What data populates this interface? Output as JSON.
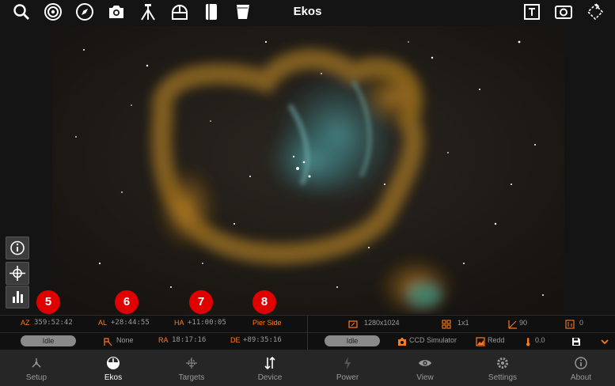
{
  "app": {
    "title": "Ekos"
  },
  "top_icons_left": [
    "search-icon",
    "target-icon",
    "compass-icon",
    "camera-icon",
    "tripod-icon",
    "observatory-icon",
    "notebook-icon",
    "flat-panel-icon"
  ],
  "top_icons_right": [
    "text-crop-icon",
    "screenshot-icon",
    "rotate-icon"
  ],
  "side_buttons": [
    "info-icon",
    "crosshair-icon",
    "histogram-icon"
  ],
  "markers": [
    "5",
    "6",
    "7",
    "8"
  ],
  "mount": {
    "az_label": "AZ",
    "az_value": "359:52:42",
    "al_label": "AL",
    "al_value": "+28:44:55",
    "ha_label": "HA",
    "ha_value": "+11:00:05",
    "pier_label": "Pier Side",
    "status": "Idle",
    "parking_value": "None",
    "ra_label": "RA",
    "ra_value": "18:17:16",
    "de_label": "DE",
    "de_value": "+89:35:16"
  },
  "camera": {
    "resolution": "1280x1024",
    "binning": "1x1",
    "rotation": "90",
    "offset": "0",
    "status": "Idle",
    "device": "CCD Simulator",
    "filter": "Redd",
    "temperature": "0.0"
  },
  "nav": [
    {
      "label": "Setup",
      "icon": "setup-icon"
    },
    {
      "label": "Ekos",
      "icon": "ekos-icon"
    },
    {
      "label": "Targets",
      "icon": "targets-icon"
    },
    {
      "label": "Device",
      "icon": "device-icon"
    },
    {
      "label": "Power",
      "icon": "power-icon"
    },
    {
      "label": "View",
      "icon": "view-icon"
    },
    {
      "label": "Settings",
      "icon": "settings-icon"
    },
    {
      "label": "About",
      "icon": "about-icon"
    }
  ],
  "colors": {
    "accent": "#ff7a1a",
    "marker": "#e00000",
    "background": "#141414",
    "nav_background": "#262626"
  }
}
